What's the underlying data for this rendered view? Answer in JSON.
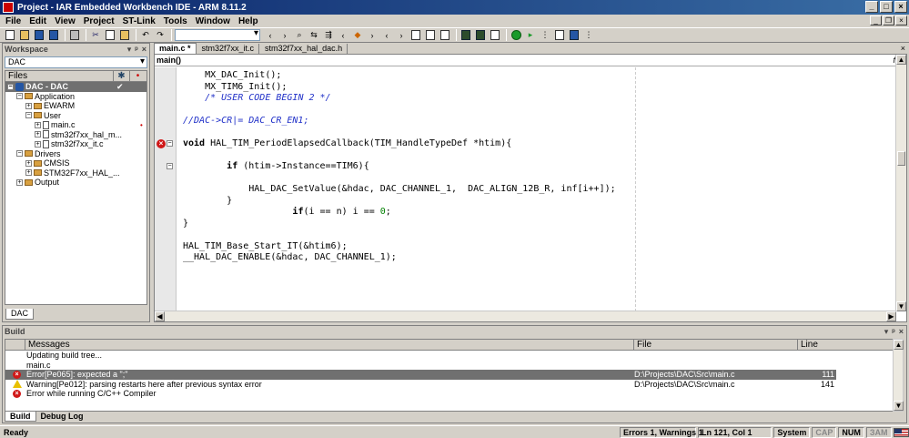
{
  "window": {
    "title": "Project - IAR Embedded Workbench IDE - ARM 8.11.2"
  },
  "menu": [
    "File",
    "Edit",
    "View",
    "Project",
    "ST-Link",
    "Tools",
    "Window",
    "Help"
  ],
  "workspace": {
    "panel_title": "Workspace",
    "config": "DAC",
    "files_header": "Files",
    "tree": [
      {
        "label": "DAC - DAC",
        "level": 0,
        "kind": "project",
        "expander": "−",
        "selected": true,
        "check": "✔"
      },
      {
        "label": "Application",
        "level": 1,
        "kind": "folder",
        "expander": "−"
      },
      {
        "label": "EWARM",
        "level": 2,
        "kind": "folder",
        "expander": "+"
      },
      {
        "label": "User",
        "level": 2,
        "kind": "folder",
        "expander": "−"
      },
      {
        "label": "main.c",
        "level": 3,
        "kind": "file",
        "expander": "+",
        "dot": "•"
      },
      {
        "label": "stm32f7xx_hal_m...",
        "level": 3,
        "kind": "file",
        "expander": "+"
      },
      {
        "label": "stm32f7xx_it.c",
        "level": 3,
        "kind": "file",
        "expander": "+"
      },
      {
        "label": "Drivers",
        "level": 1,
        "kind": "folder",
        "expander": "−"
      },
      {
        "label": "CMSIS",
        "level": 2,
        "kind": "folder",
        "expander": "+"
      },
      {
        "label": "STM32F7xx_HAL_...",
        "level": 2,
        "kind": "folder",
        "expander": "+"
      },
      {
        "label": "Output",
        "level": 1,
        "kind": "folder",
        "expander": "+"
      }
    ],
    "bottom_tab": "DAC"
  },
  "editor": {
    "tabs": [
      {
        "label": "main.c *",
        "active": true
      },
      {
        "label": "stm32f7xx_it.c",
        "active": false
      },
      {
        "label": "stm32f7xx_hal_dac.h",
        "active": false
      }
    ],
    "function_selector": "main()",
    "function_icon": "f()",
    "lines": [
      {
        "text": "MX_DAC_Init();",
        "indent": 1,
        "style": "plain"
      },
      {
        "text": "MX_TIM6_Init();",
        "indent": 1,
        "style": "plain"
      },
      {
        "text": "/* USER CODE BEGIN 2 */",
        "indent": 1,
        "style": "comment"
      },
      {
        "text": "",
        "style": "plain"
      },
      {
        "text": "//DAC->CR|= DAC_CR_EN1;",
        "indent": 0,
        "style": "comment"
      },
      {
        "text": "",
        "style": "plain"
      },
      {
        "text": "void HAL_TIM_PeriodElapsedCallback(TIM_HandleTypeDef *htim){",
        "indent": 0,
        "style": "decl",
        "error": true,
        "fold": true
      },
      {
        "text": "",
        "style": "plain"
      },
      {
        "text": "if (htim->Instance==TIM6){",
        "indent": 2,
        "style": "if",
        "fold": true
      },
      {
        "text": "",
        "style": "plain"
      },
      {
        "text": "HAL_DAC_SetValue(&hdac, DAC_CHANNEL_1,  DAC_ALIGN_12B_R, inf[i++]);",
        "indent": 3,
        "style": "plain"
      },
      {
        "text": "}",
        "indent": 2,
        "style": "plain"
      },
      {
        "text": "if(i == n) i == 0;",
        "indent": 5,
        "style": "if2"
      },
      {
        "text": "}",
        "indent": 0,
        "style": "plain"
      },
      {
        "text": "",
        "style": "plain"
      },
      {
        "text": "HAL_TIM_Base_Start_IT(&htim6);",
        "indent": 0,
        "style": "plain"
      },
      {
        "text": "__HAL_DAC_ENABLE(&hdac, DAC_CHANNEL_1);",
        "indent": 0,
        "style": "plain"
      }
    ]
  },
  "build": {
    "title": "Build",
    "headers": {
      "messages": "Messages",
      "file": "File",
      "line": "Line"
    },
    "rows": [
      {
        "icon": "",
        "message": "Updating build tree...",
        "file": "",
        "line": ""
      },
      {
        "icon": "",
        "message": "main.c",
        "file": "",
        "line": ""
      },
      {
        "icon": "error",
        "message": "Error[Pe065]: expected a \";\"",
        "file": "D:\\Projects\\DAC\\Src\\main.c",
        "line": "111",
        "selected": true
      },
      {
        "icon": "warning",
        "message": "Warning[Pe012]: parsing restarts here after previous syntax error",
        "file": "D:\\Projects\\DAC\\Src\\main.c",
        "line": "141"
      },
      {
        "icon": "error",
        "message": "Error while running C/C++ Compiler",
        "file": "",
        "line": ""
      }
    ],
    "tabs": [
      "Build",
      "Debug Log"
    ]
  },
  "status": {
    "ready": "Ready",
    "errors": "Errors 1, Warnings 1",
    "position": "Ln 121, Col 1",
    "system": "System",
    "cap": "CAP",
    "num": "NUM",
    "ovr": "ЗАМ"
  }
}
